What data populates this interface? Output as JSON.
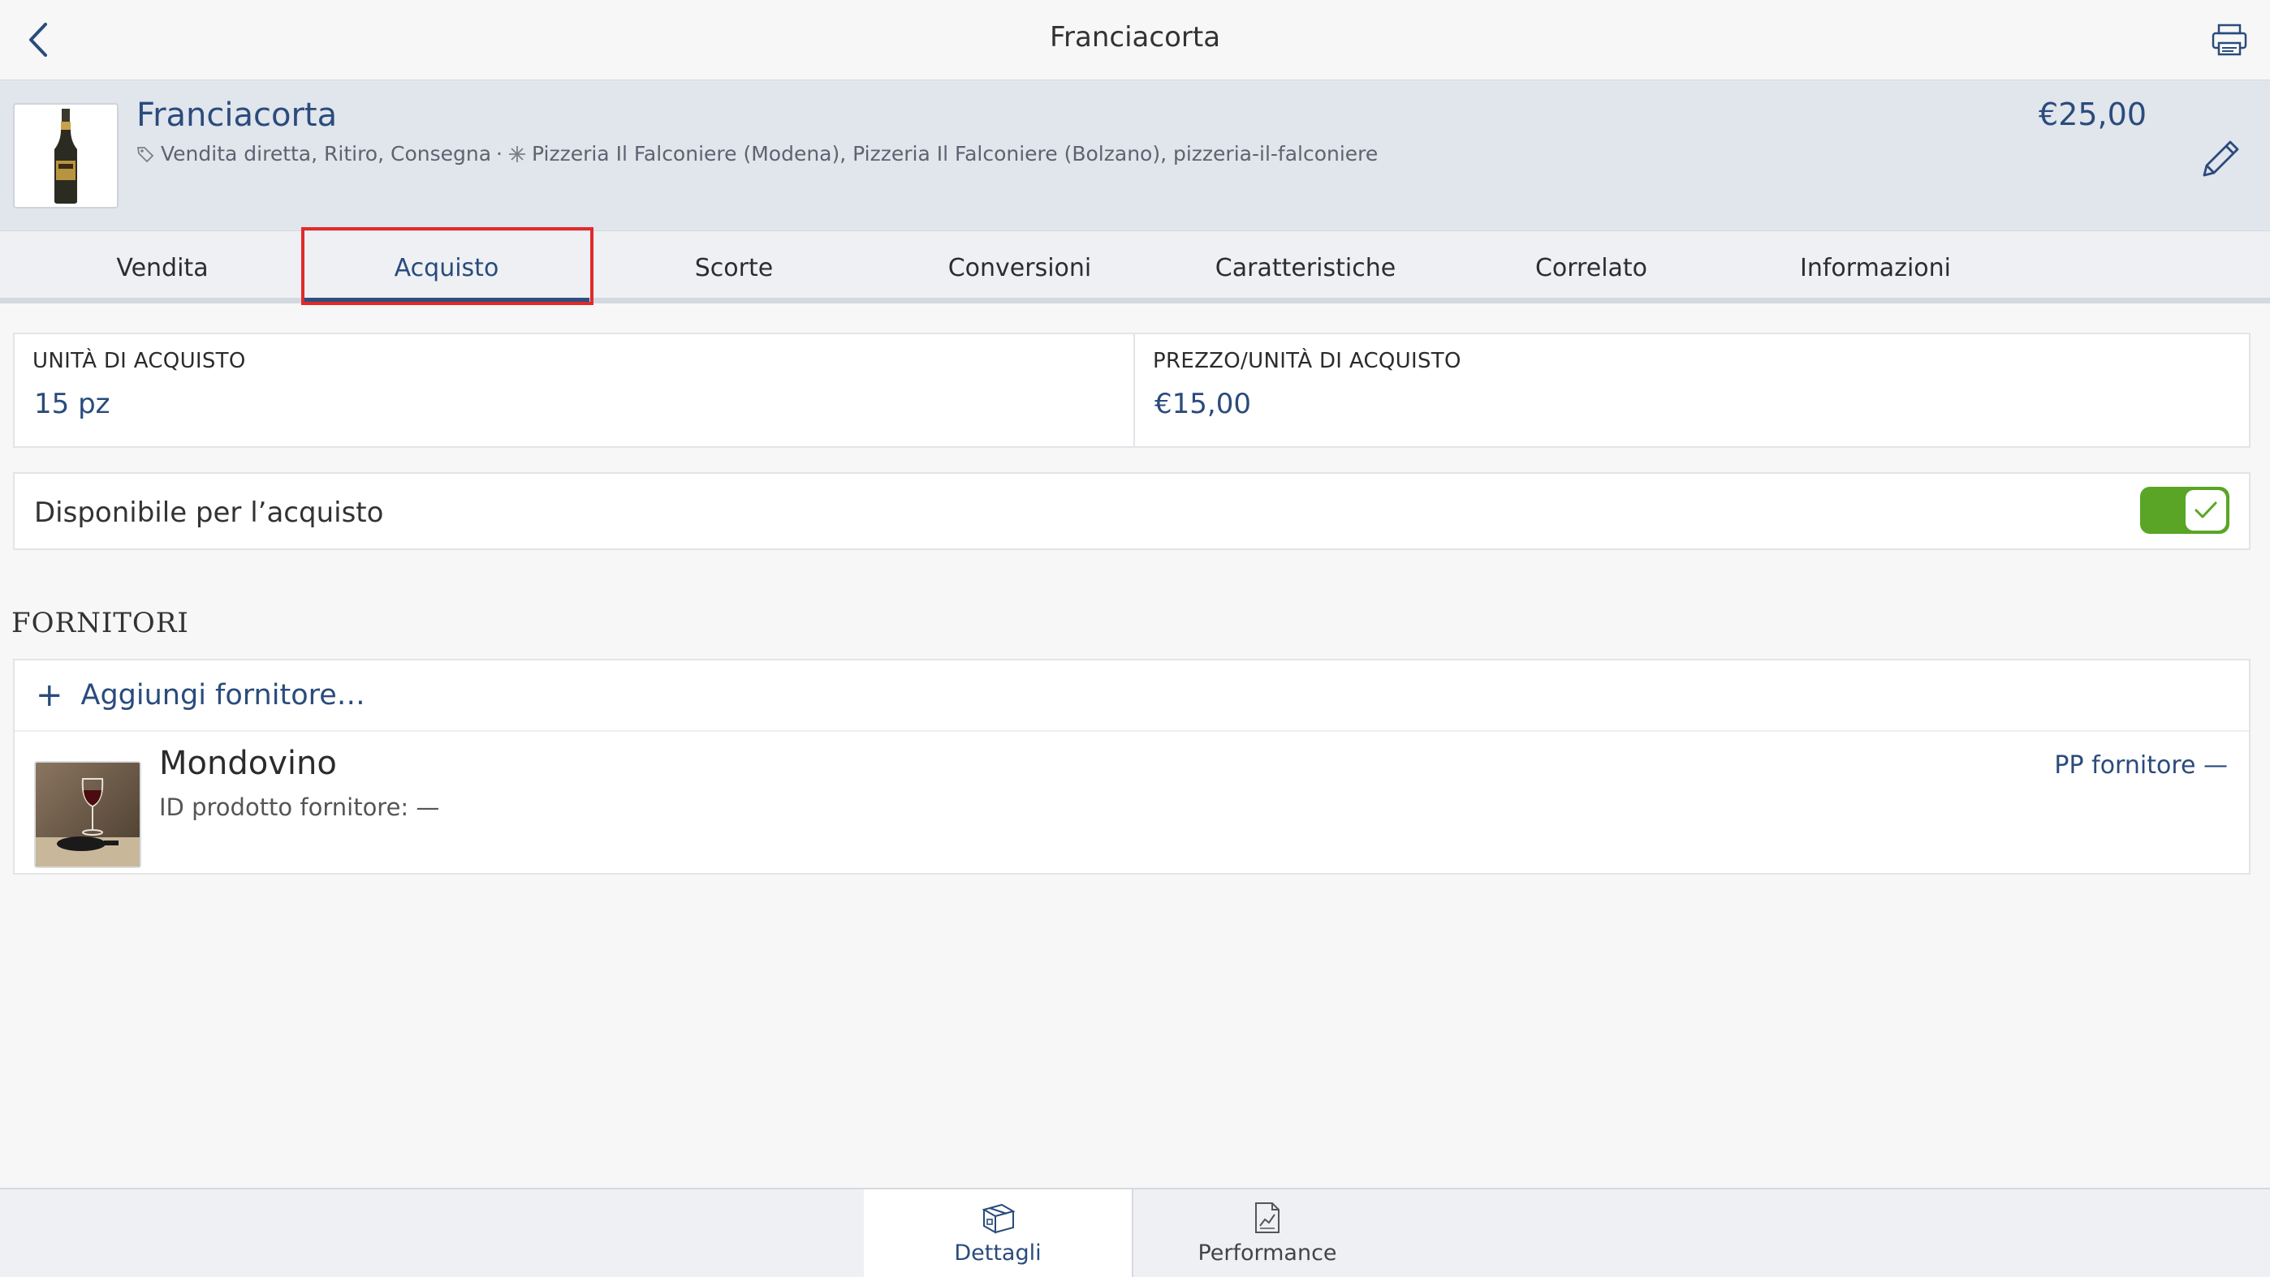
{
  "navbar": {
    "title": "Franciacorta",
    "back_icon": "chevron-left-icon",
    "printer_icon": "printer-icon"
  },
  "product": {
    "name": "Franciacorta",
    "channels": "Vendita diretta, Ritiro, Consegna",
    "separator": "·",
    "locations": "Pizzeria Il Falconiere (Modena), Pizzeria Il Falconiere (Bolzano), pizzeria-il-falconiere",
    "price": "€25,00",
    "edit_icon": "pencil-icon"
  },
  "tabs": [
    {
      "label": "Vendita"
    },
    {
      "label": "Acquisto",
      "active": true
    },
    {
      "label": "Scorte"
    },
    {
      "label": "Conversioni"
    },
    {
      "label": "Caratteristiche"
    },
    {
      "label": "Correlato"
    },
    {
      "label": "Informazioni"
    }
  ],
  "purchase": {
    "unit_label": "UNITÀ DI ACQUISTO",
    "unit_value": "15 pz",
    "price_label": "PREZZO/UNITÀ DI ACQUISTO",
    "price_value": "€15,00"
  },
  "availability": {
    "label": "Disponibile per l’acquisto",
    "enabled": true
  },
  "suppliers": {
    "section_title": "FORNITORI",
    "add_label": "Aggiungi fornitore…",
    "items": [
      {
        "name": "Mondovino",
        "id_label": "ID prodotto fornitore: —",
        "pp_label": "PP fornitore —"
      }
    ]
  },
  "bottom_tabs": [
    {
      "label": "Dettagli",
      "icon": "box-icon",
      "active": true
    },
    {
      "label": "Performance",
      "icon": "chart-document-icon",
      "active": false
    }
  ],
  "colors": {
    "accent": "#2a4b7c",
    "toggle_on": "#5aa526",
    "highlight": "#e02a2a"
  }
}
